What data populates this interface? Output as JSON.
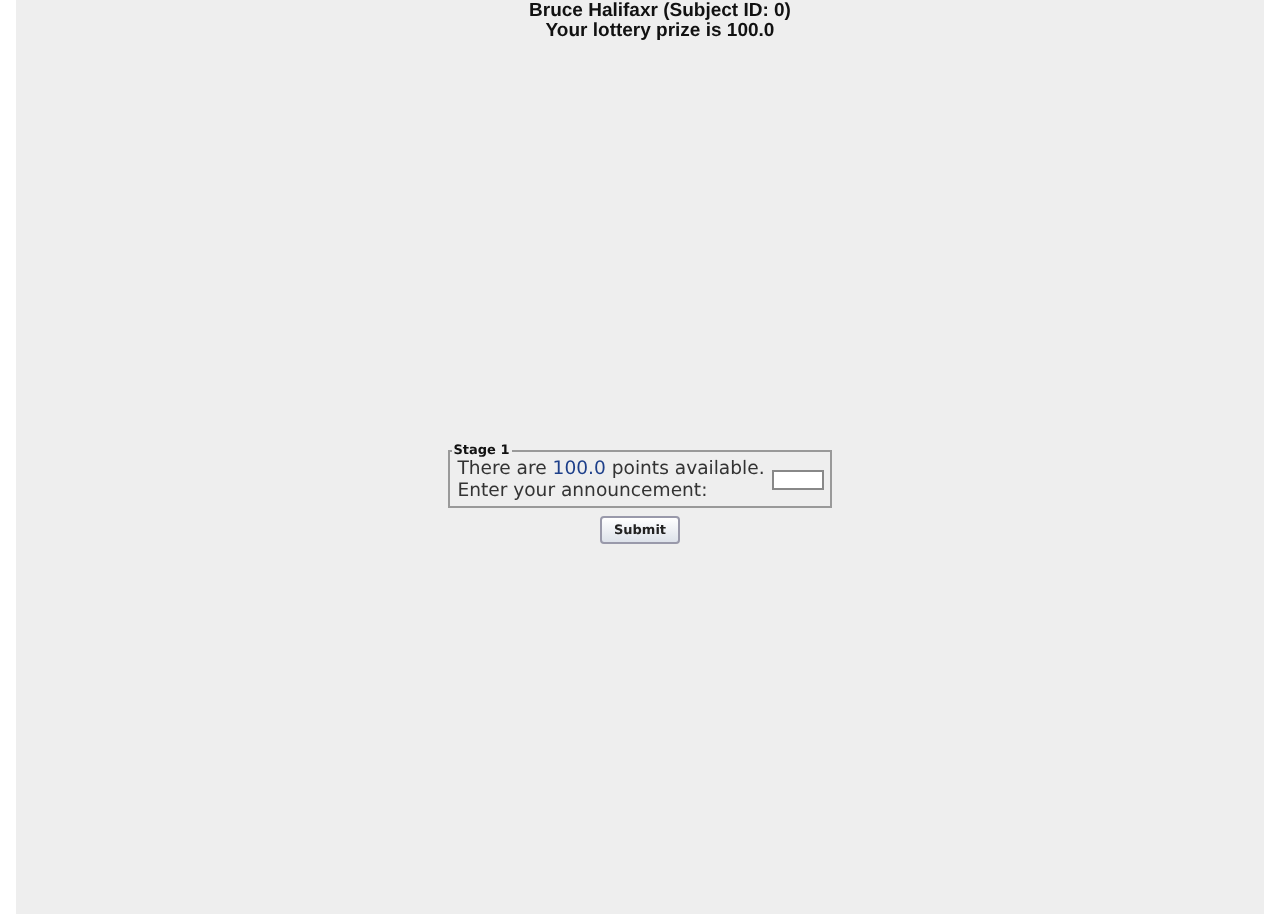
{
  "header": {
    "subject_line": "Bruce Halifaxr (Subject ID: 0)",
    "prize_line": "Your lottery prize is 100.0"
  },
  "stage": {
    "title": "Stage 1",
    "text_before": "There are ",
    "points": "100.0",
    "text_after": " points available.",
    "prompt": "Enter your announcement:"
  },
  "submit_button": "Submit"
}
